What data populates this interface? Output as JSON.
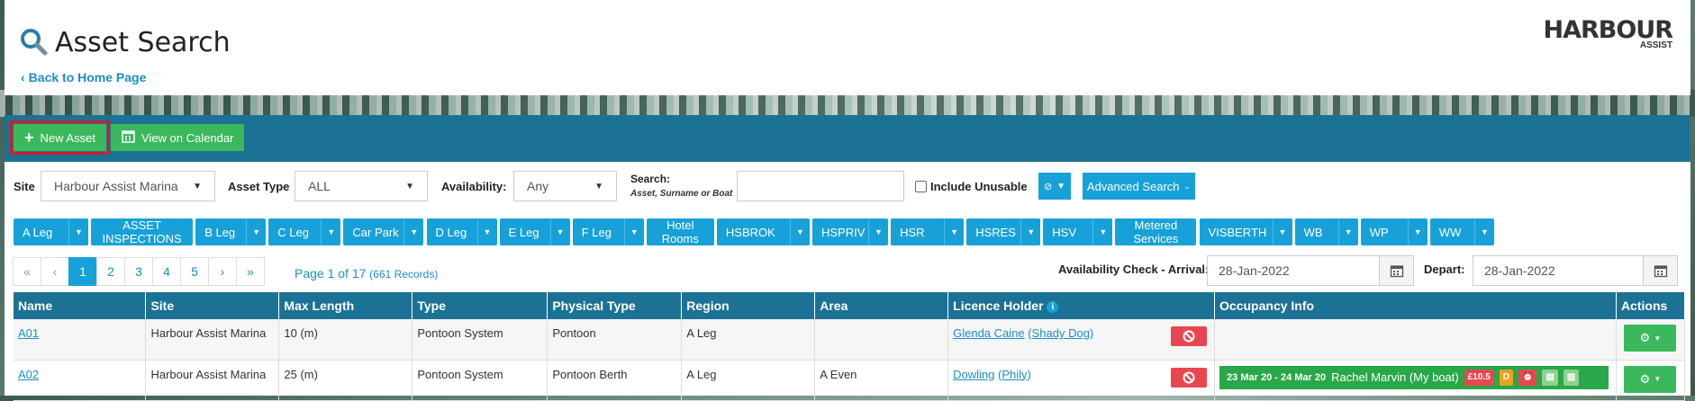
{
  "header": {
    "title": "Asset Search",
    "back_link": "Back to Home Page",
    "logo_main": "HARBOUR",
    "logo_sub": "ASSIST"
  },
  "toolbar": {
    "new_asset": "New Asset",
    "view_calendar": "View on Calendar"
  },
  "filters": {
    "site_label": "Site",
    "site_value": "Harbour Assist Marina",
    "asset_type_label": "Asset Type",
    "asset_type_value": "ALL",
    "availability_label": "Availability:",
    "availability_value": "Any",
    "search_label": "Search:",
    "search_sub": "Asset, Surname or Boat",
    "search_value": "",
    "include_unusable": "Include Unusable",
    "advanced_search": "Advanced Search"
  },
  "tags": [
    {
      "label": "A Leg",
      "dropdown": true
    },
    {
      "label": "ASSET INSPECTIONS",
      "dropdown": false
    },
    {
      "label": "B Leg",
      "dropdown": true
    },
    {
      "label": "C Leg",
      "dropdown": true
    },
    {
      "label": "Car Park",
      "dropdown": true
    },
    {
      "label": "D Leg",
      "dropdown": true
    },
    {
      "label": "E Leg",
      "dropdown": true
    },
    {
      "label": "F Leg",
      "dropdown": true
    },
    {
      "label": "Hotel Rooms",
      "dropdown": false
    },
    {
      "label": "HSBROK",
      "dropdown": true
    },
    {
      "label": "HSPRIV",
      "dropdown": true
    },
    {
      "label": "HSR",
      "dropdown": true
    },
    {
      "label": "HSRES",
      "dropdown": true
    },
    {
      "label": "HSV",
      "dropdown": true
    },
    {
      "label": "Metered Services",
      "dropdown": false
    },
    {
      "label": "VISBERTH",
      "dropdown": true
    },
    {
      "label": "WB",
      "dropdown": true
    },
    {
      "label": "WP",
      "dropdown": true
    },
    {
      "label": "WW",
      "dropdown": true
    }
  ],
  "pagination": {
    "first": "«",
    "prev": "‹",
    "pages": [
      "1",
      "2",
      "3",
      "4",
      "5"
    ],
    "next": "›",
    "last": "»",
    "current": "1",
    "info": "Page 1 of 17",
    "records": "(661 Records)"
  },
  "availability_check": {
    "arrival_label": "Availability Check - Arrival:",
    "arrival_value": "28-Jan-2022",
    "depart_label": "Depart:",
    "depart_value": "28-Jan-2022"
  },
  "table": {
    "columns": [
      "Name",
      "Site",
      "Max Length",
      "Type",
      "Physical Type",
      "Region",
      "Area",
      "Licence Holder",
      "Occupancy Info",
      "Actions"
    ],
    "rows": [
      {
        "name": "A01",
        "site": "Harbour Assist Marina",
        "max_length": "10 (m)",
        "type": "Pontoon System",
        "physical_type": "Pontoon",
        "region": "A Leg",
        "area": "",
        "holder": "Glenda Caine",
        "boat": "(Shady Dog)"
      },
      {
        "name": "A02",
        "site": "Harbour Assist Marina",
        "max_length": "25 (m)",
        "type": "Pontoon System",
        "physical_type": "Pontoon Berth",
        "region": "A Leg",
        "area": "A Even",
        "holder": "Dowling",
        "boat": "(Phily)",
        "occupancy": {
          "dates": "23 Mar 20 - 24 Mar 20",
          "guest": "Rachel Marvin (My boat)",
          "amount": "£10.5",
          "flag": "D"
        }
      }
    ]
  },
  "colors": {
    "primary": "#1c7294",
    "accent": "#17a1d8",
    "green": "#3bb85c",
    "red": "#e8474f",
    "highlight": "#d11d2b"
  }
}
